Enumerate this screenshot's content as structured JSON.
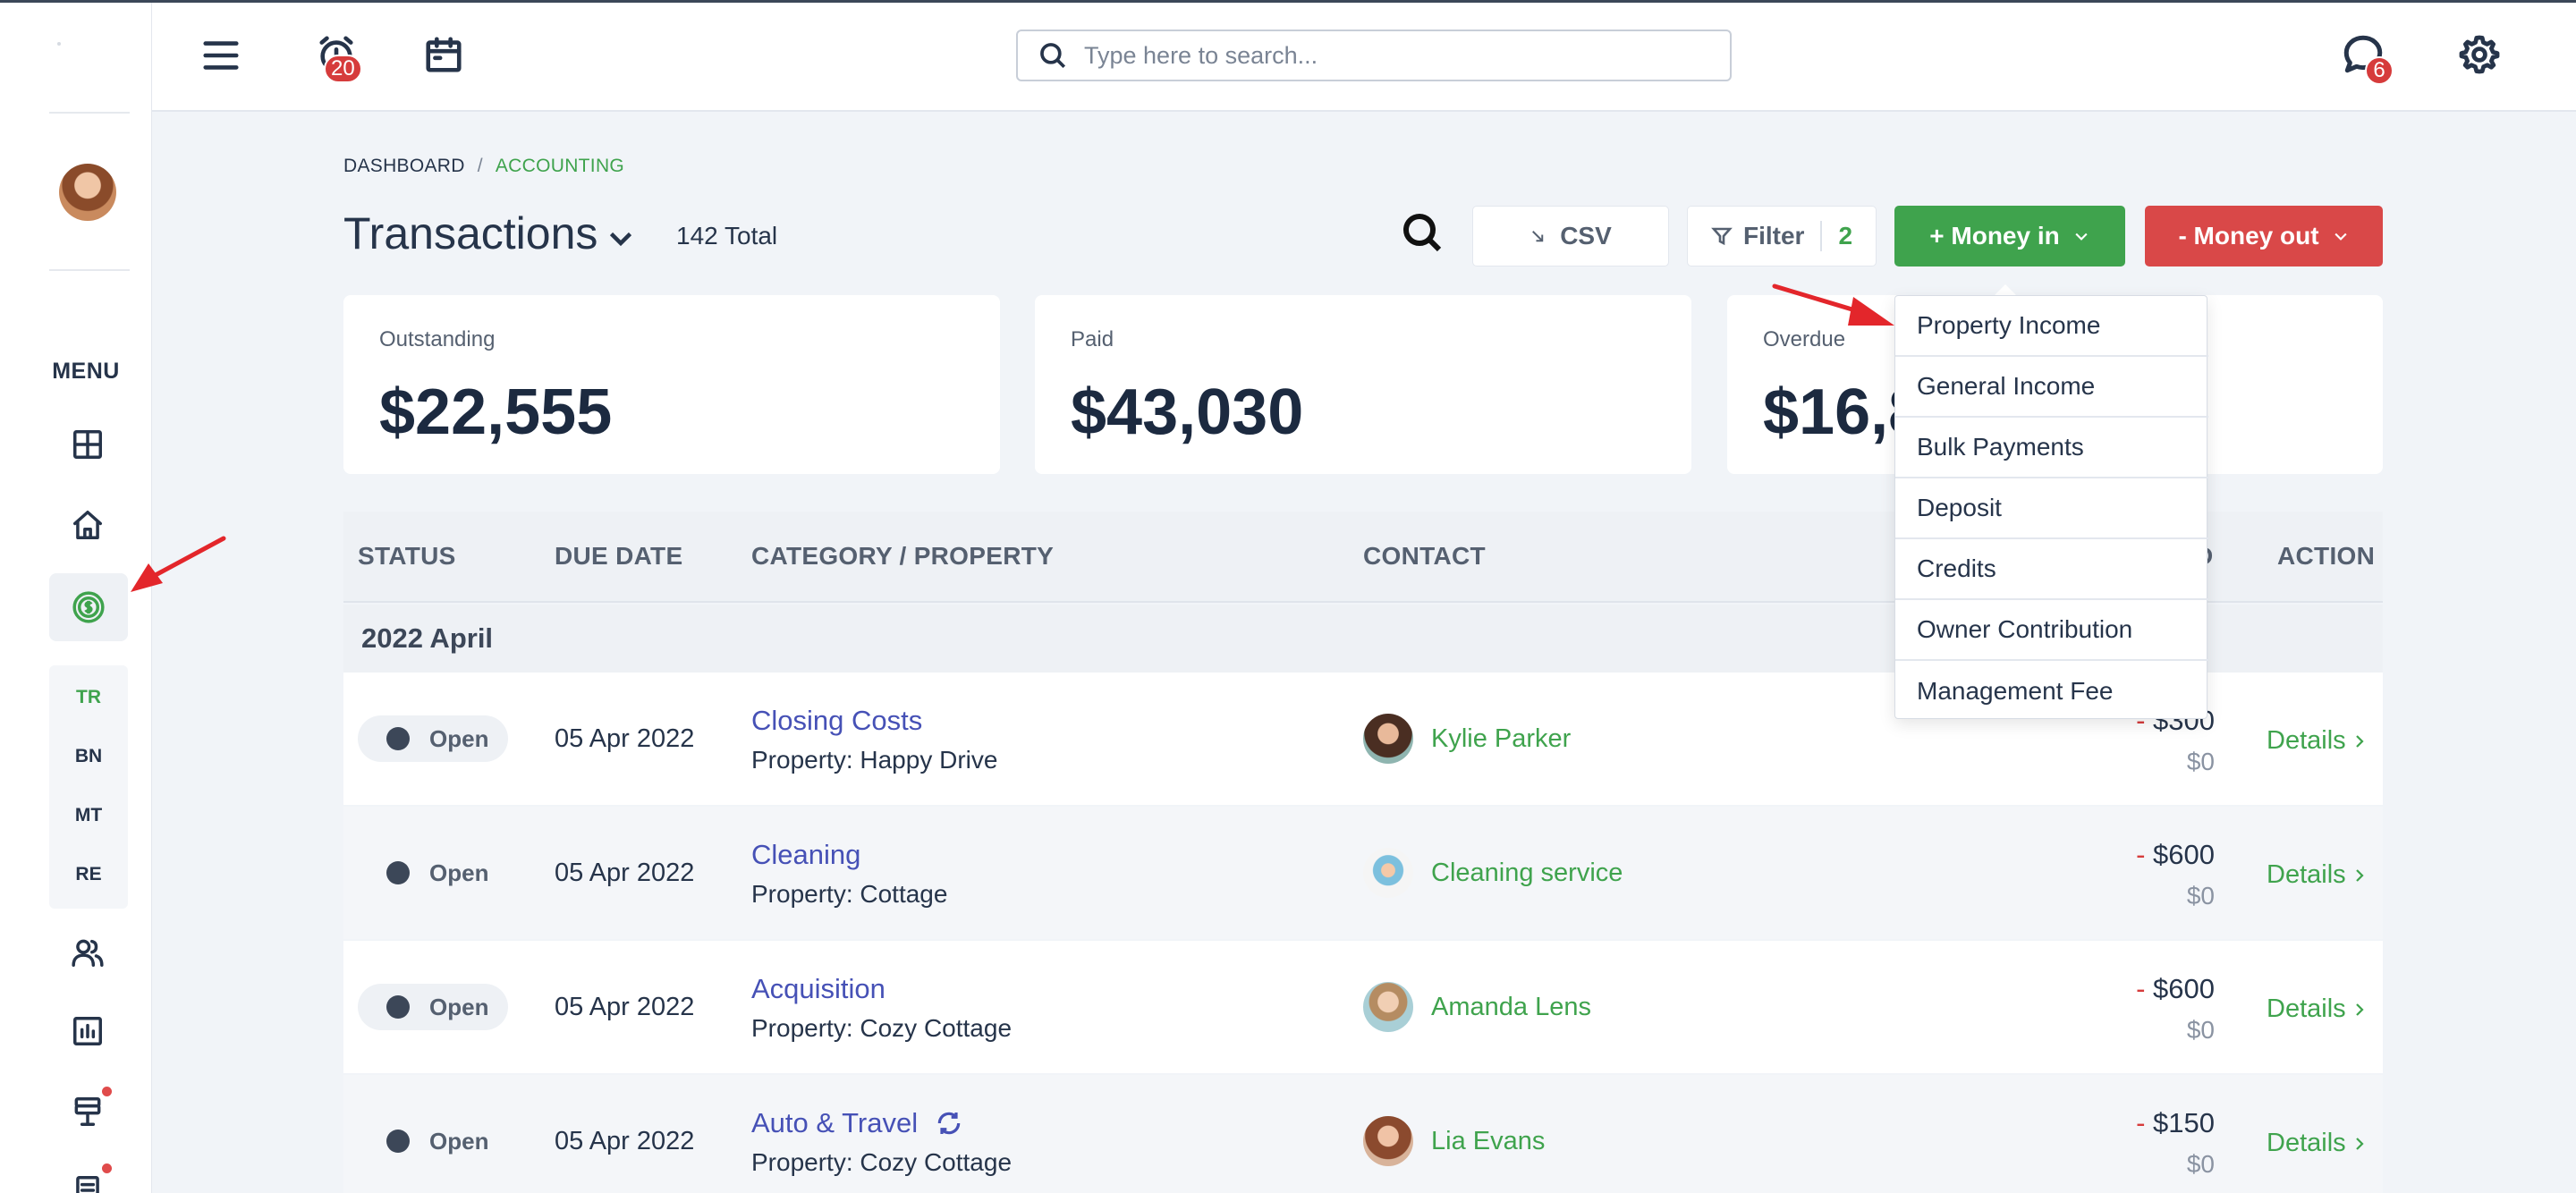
{
  "header": {
    "search_placeholder": "Type here to search...",
    "alarm_badge": "20",
    "chat_badge": "6"
  },
  "sidebar": {
    "menu_label": "MENU",
    "sub_items": [
      "TR",
      "BN",
      "MT",
      "RE"
    ]
  },
  "breadcrumb": {
    "root": "DASHBOARD",
    "separator": "/",
    "current": "ACCOUNTING"
  },
  "page": {
    "title": "Transactions",
    "total": "142 Total"
  },
  "toolbar": {
    "csv": "CSV",
    "filter": "Filter",
    "filter_count": "2",
    "money_in": "+ Money in",
    "money_out": "- Money out"
  },
  "cards": [
    {
      "label": "Outstanding",
      "value": "$22,555"
    },
    {
      "label": "Paid",
      "value": "$43,030"
    },
    {
      "label": "Overdue",
      "value": "$16,8"
    }
  ],
  "table": {
    "headers": [
      "STATUS",
      "DUE DATE",
      "CATEGORY / PROPERTY",
      "CONTACT",
      "D",
      "ACTION"
    ],
    "group": "2022 April",
    "rows": [
      {
        "status": "Open",
        "due": "05 Apr 2022",
        "category": "Closing Costs",
        "property": "Property: Happy Drive",
        "contact": "Kylie Parker",
        "amount_sign": "-",
        "amount": "$300",
        "paid": "$0",
        "action": "Details"
      },
      {
        "status": "Open",
        "due": "05 Apr 2022",
        "category": "Cleaning",
        "property": "Property: Cottage",
        "contact": "Cleaning service",
        "amount_sign": "-",
        "amount": "$600",
        "paid": "$0",
        "action": "Details"
      },
      {
        "status": "Open",
        "due": "05 Apr 2022",
        "category": "Acquisition",
        "property": "Property: Cozy Cottage",
        "contact": "Amanda Lens",
        "amount_sign": "-",
        "amount": "$600",
        "paid": "$0",
        "action": "Details"
      },
      {
        "status": "Open",
        "due": "05 Apr 2022",
        "category": "Auto & Travel",
        "property": "Property: Cozy Cottage",
        "contact": "Lia Evans",
        "amount_sign": "-",
        "amount": "$150",
        "paid": "$0",
        "action": "Details"
      }
    ]
  },
  "money_in_menu": [
    "Property Income",
    "General Income",
    "Bulk Payments",
    "Deposit",
    "Credits",
    "Owner Contribution",
    "Management Fee"
  ],
  "colors": {
    "accent_green": "#3fa34d",
    "danger_red": "#d94848",
    "link_purple": "#4651b6",
    "annotation_red": "#e3262b"
  }
}
